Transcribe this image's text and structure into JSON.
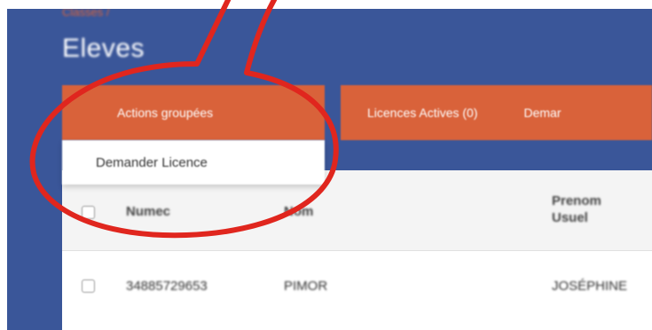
{
  "breadcrumb": "Classes /",
  "title": "Eleves",
  "toolbar": {
    "actions_label": "Actions groupées",
    "licences_label": "Licences Actives (0)",
    "demand_label": "Demar"
  },
  "dropdown": {
    "item": "Demander Licence"
  },
  "table": {
    "headers": {
      "numero": "Numec",
      "nom": "Nom",
      "prenom_line1": "Prenom",
      "prenom_line2": "Usuel"
    },
    "rows": [
      {
        "numero": "34885729653",
        "nom": "PIMOR",
        "prenom": "JOSÉPHINE"
      }
    ]
  },
  "colors": {
    "header_bg": "#3a5699",
    "accent": "#d9623a",
    "annotation": "#e0261e"
  },
  "icons": {
    "checkbox": "checkbox-icon",
    "annotation": "hand-drawn-circle"
  }
}
